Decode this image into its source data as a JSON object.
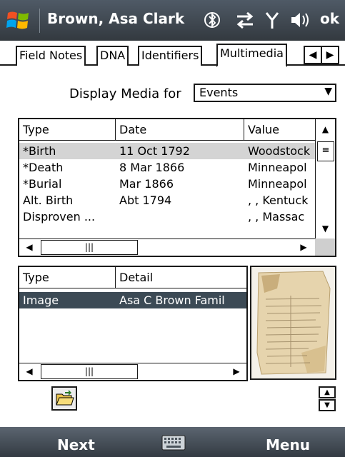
{
  "titlebar": {
    "title": "Brown, Asa Clark",
    "ok_label": "ok",
    "icons": [
      "windows-logo",
      "bluetooth-icon",
      "connectivity-icon",
      "signal-icon",
      "volume-icon"
    ]
  },
  "tabs": [
    {
      "label": "Field Notes",
      "active": false
    },
    {
      "label": "DNA",
      "active": false
    },
    {
      "label": "Identifiers",
      "active": false
    },
    {
      "label": "Multimedia",
      "active": true
    }
  ],
  "tab_scroll": {
    "left": "◀",
    "right": "▶"
  },
  "display_media": {
    "label": "Display Media for",
    "selected": "Events",
    "arrow": "▼"
  },
  "events_table": {
    "columns": [
      "Type",
      "Date",
      "Value"
    ],
    "rows": [
      {
        "type": "*Birth",
        "date": "11 Oct 1792",
        "value": "Woodstock",
        "selected": true
      },
      {
        "type": "*Death",
        "date": "8 Mar 1866",
        "value": "Minneapol",
        "selected": false
      },
      {
        "type": "*Burial",
        "date": "Mar 1866",
        "value": "Minneapol",
        "selected": false
      },
      {
        "type": "Alt. Birth",
        "date": "Abt 1794",
        "value": ", , Kentuck",
        "selected": false
      },
      {
        "type": "Disproven ...",
        "date": "",
        "value": ", , Massac",
        "selected": false
      }
    ]
  },
  "media_table": {
    "columns": [
      "Type",
      "Detail"
    ],
    "rows": [
      {
        "type": "Image",
        "detail": "Asa C Brown Famil",
        "selected": true
      }
    ]
  },
  "scroll_glyphs": {
    "up": "▲",
    "down": "▼",
    "left": "◀",
    "right": "▶",
    "grip": "|||",
    "hgrip": "≡"
  },
  "softkeys": {
    "left": "Next",
    "right": "Menu"
  },
  "colors": {
    "titlebar": "#3d454d",
    "selection_highlight": "#3c4a55",
    "event_selection": "#d4d4d4"
  }
}
